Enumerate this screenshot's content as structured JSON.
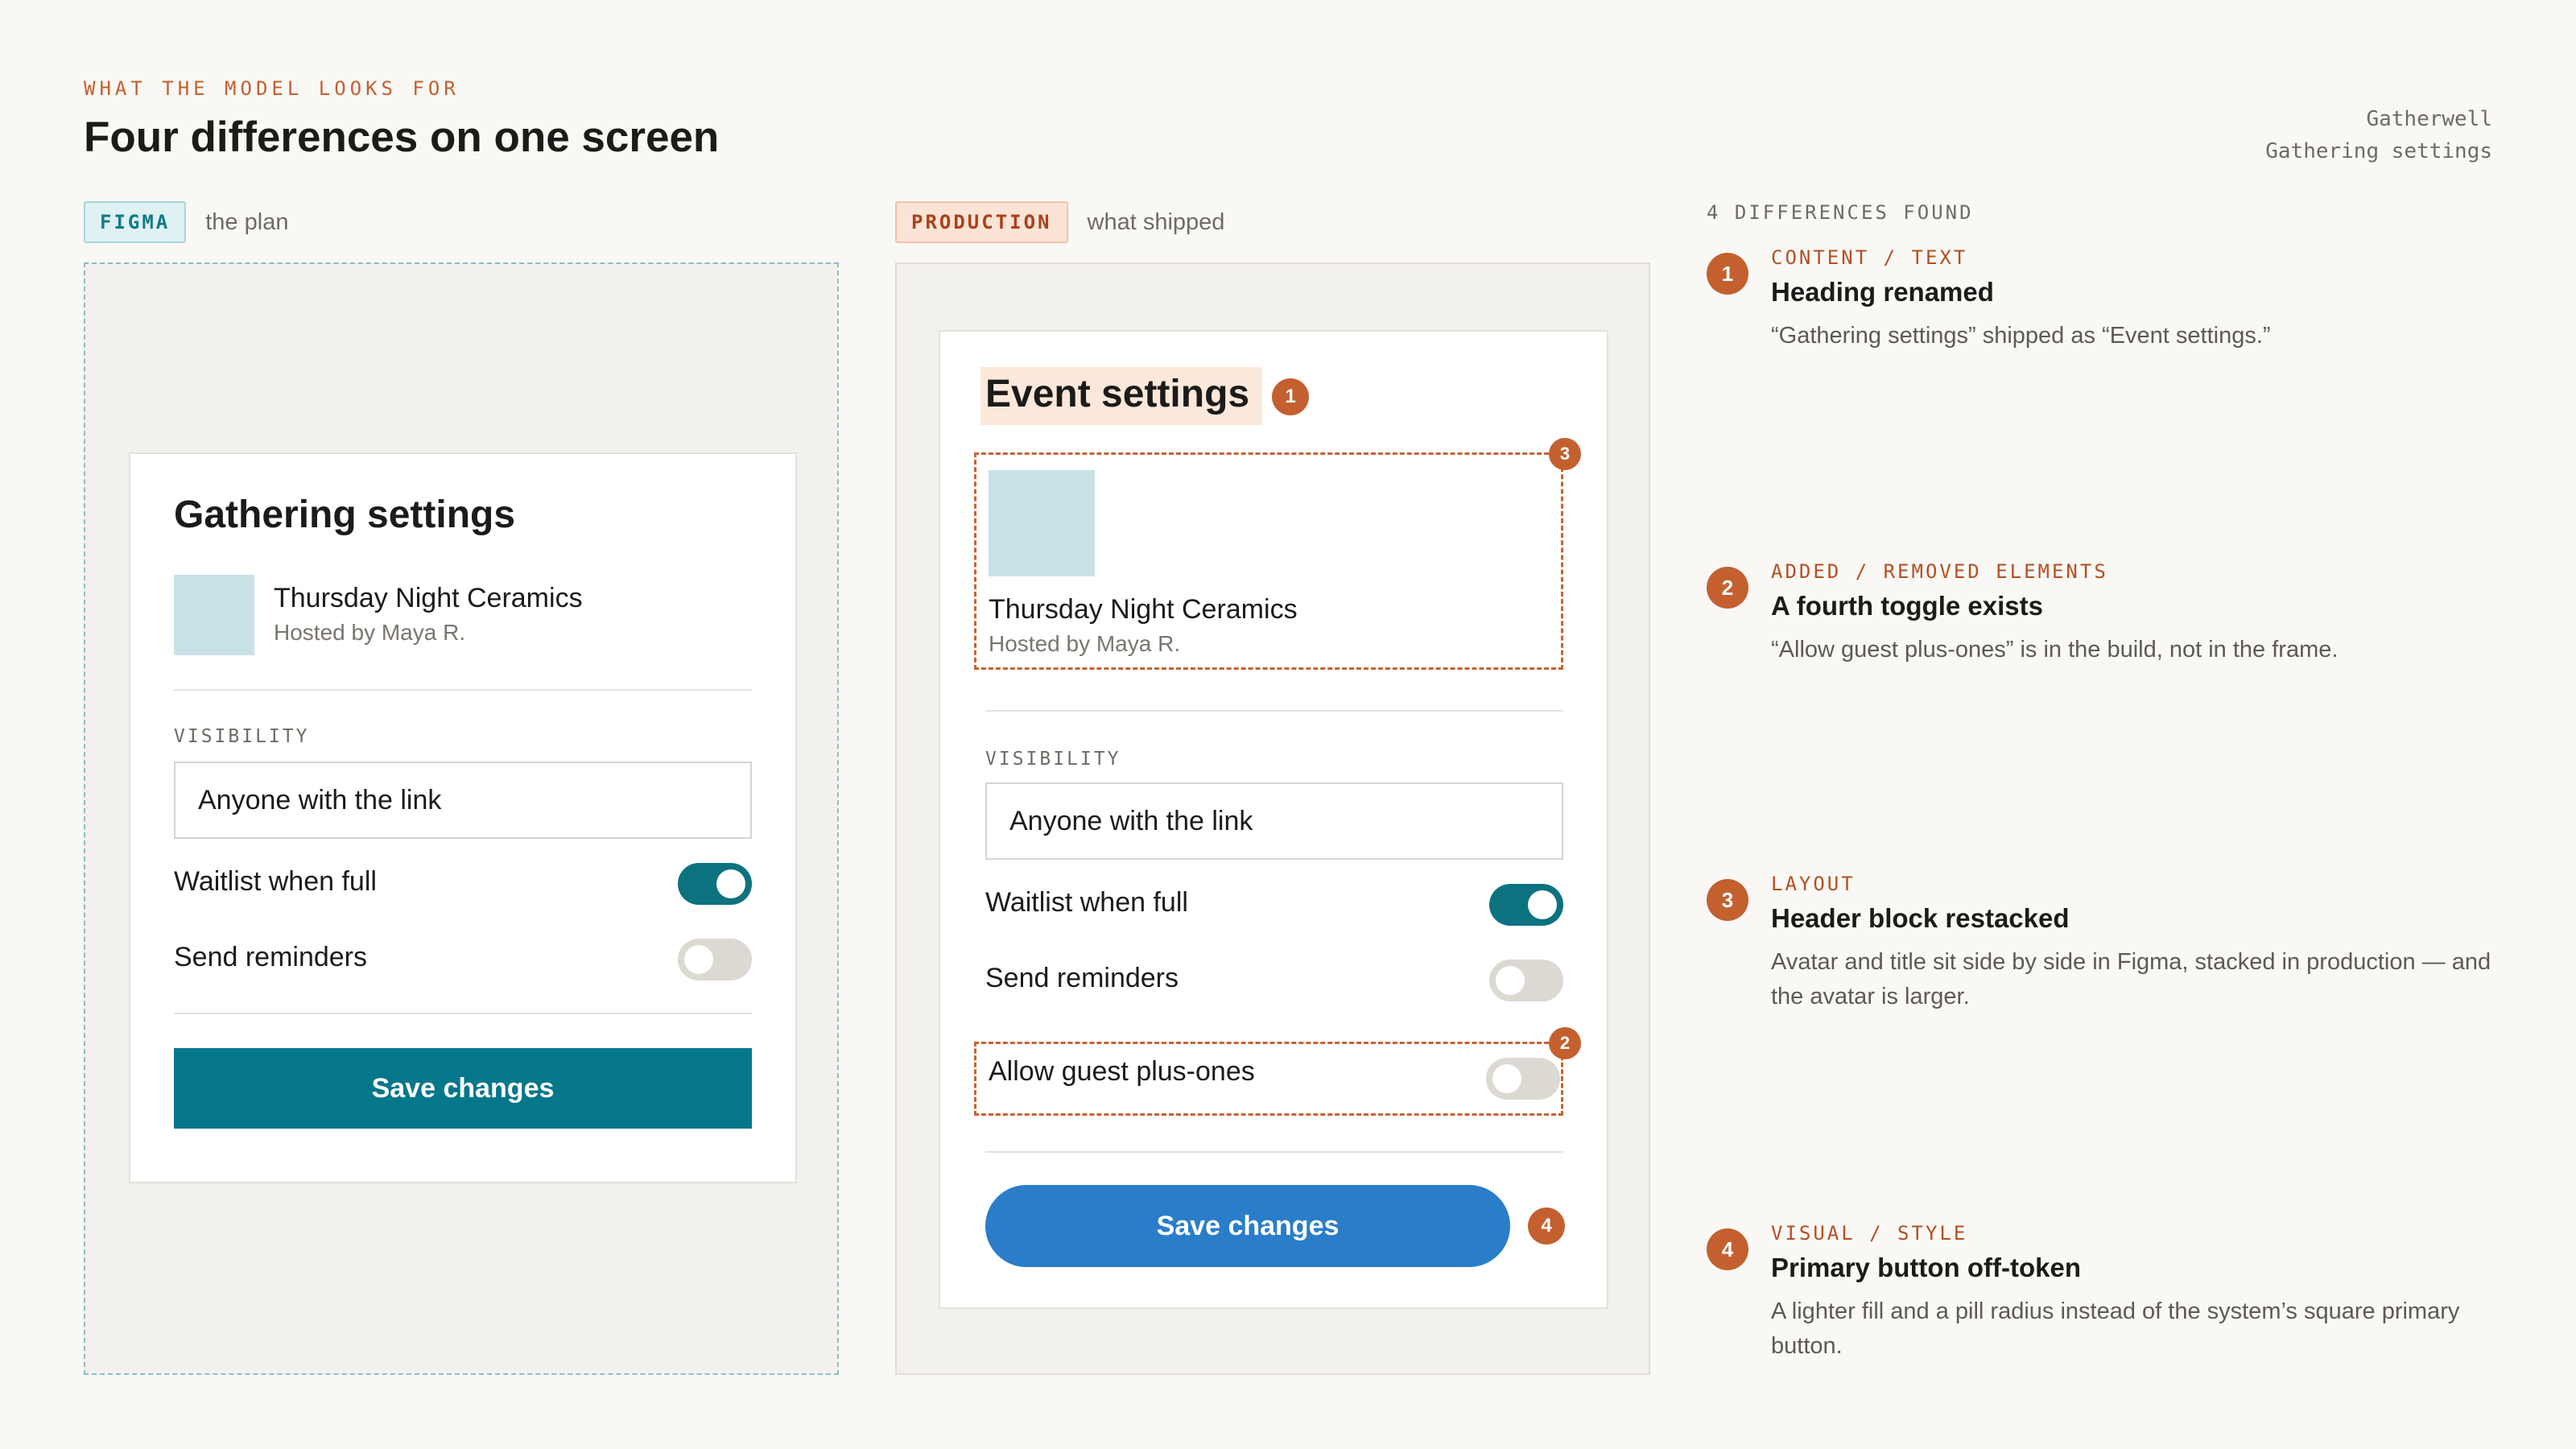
{
  "header": {
    "eyebrow": "WHAT THE MODEL LOOKS FOR",
    "title": "Four differences on one screen",
    "brand_name": "Gatherwell",
    "brand_page": "Gathering settings"
  },
  "figma": {
    "tag": "FIGMA",
    "note": "the plan",
    "card": {
      "heading": "Gathering settings",
      "event_name": "Thursday Night Ceramics",
      "event_host": "Hosted by Maya R.",
      "visibility_label": "VISIBILITY",
      "visibility_value": "Anyone with the link",
      "toggles": [
        {
          "label": "Waitlist when full",
          "on": true
        },
        {
          "label": "Send reminders",
          "on": false
        }
      ],
      "button": "Save changes"
    }
  },
  "production": {
    "tag": "PRODUCTION",
    "note": "what shipped",
    "card": {
      "heading": "Event settings",
      "event_name": "Thursday Night Ceramics",
      "event_host": "Hosted by Maya R.",
      "visibility_label": "VISIBILITY",
      "visibility_value": "Anyone with the link",
      "toggles": [
        {
          "label": "Waitlist when full",
          "on": true
        },
        {
          "label": "Send reminders",
          "on": false
        },
        {
          "label": "Allow guest plus-ones",
          "on": false
        }
      ],
      "button": "Save changes"
    },
    "markers": [
      "1",
      "2",
      "3",
      "4"
    ]
  },
  "differences": {
    "header": "4 DIFFERENCES FOUND",
    "items": [
      {
        "num": "1",
        "category": "CONTENT / TEXT",
        "title": "Heading renamed",
        "desc": "“Gathering settings” shipped as “Event settings.”"
      },
      {
        "num": "2",
        "category": "ADDED / REMOVED ELEMENTS",
        "title": "A fourth toggle exists",
        "desc": "“Allow guest plus-ones” is in the build, not in the frame."
      },
      {
        "num": "3",
        "category": "LAYOUT",
        "title": "Header block restacked",
        "desc": "Avatar and title sit side by side in Figma, stacked in production — and the avatar is larger."
      },
      {
        "num": "4",
        "category": "VISUAL / STYLE",
        "title": "Primary button off-token",
        "desc": "A lighter fill and a pill radius instead of the system’s square primary button."
      }
    ]
  },
  "colors": {
    "accent": "#c4602f",
    "figma_primary": "#05778a",
    "prod_primary": "#2a7dc9",
    "toggle_on": "#0d7280",
    "toggle_off": "#dcd8d2"
  }
}
